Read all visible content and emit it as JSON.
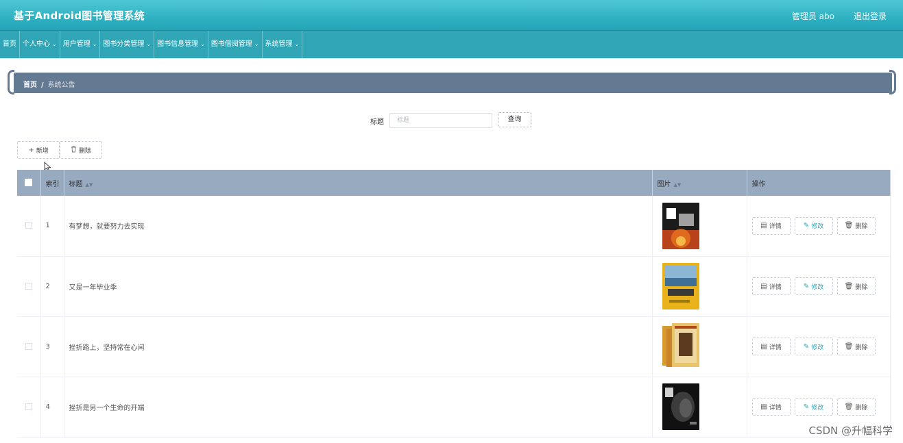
{
  "header": {
    "app_title": "基于Android图书管理系统",
    "user": "管理员 abo",
    "logout": "退出登录"
  },
  "nav": [
    {
      "label": "首页",
      "dropdown": false
    },
    {
      "label": "个人中心",
      "dropdown": true
    },
    {
      "label": "用户管理",
      "dropdown": true
    },
    {
      "label": "图书分类管理",
      "dropdown": true
    },
    {
      "label": "图书信息管理",
      "dropdown": true
    },
    {
      "label": "图书借阅管理",
      "dropdown": true
    },
    {
      "label": "系统管理",
      "dropdown": true
    }
  ],
  "breadcrumb": {
    "home": "首页",
    "separator": "/",
    "current": "系统公告"
  },
  "search": {
    "label": "标题",
    "placeholder": "标题",
    "button": "查询"
  },
  "actions": {
    "add": "新增",
    "delete": "删除"
  },
  "table": {
    "headers": {
      "index": "索引",
      "title": "标题",
      "image": "图片",
      "ops": "操作"
    },
    "rows": [
      {
        "index": "1",
        "title": "有梦想，就要努力去实现",
        "thumb": "book-cover-dark-fire"
      },
      {
        "index": "2",
        "title": "又是一年毕业季",
        "thumb": "book-cover-yellow"
      },
      {
        "index": "3",
        "title": "挫折路上，坚持常在心间",
        "thumb": "book-cover-box-set"
      },
      {
        "index": "4",
        "title": "挫折是另一个生命的开端",
        "thumb": "book-cover-portrait"
      }
    ],
    "row_ops": {
      "detail": "详情",
      "edit": "修改",
      "remove": "删除"
    }
  },
  "colors": {
    "header": "#2fb1c2",
    "nav": "#2fa5b6",
    "breadcrumb": "#647a92",
    "table_header": "#98aac0",
    "edit_accent": "#2aa3b5"
  },
  "watermark": "CSDN @升幅科学"
}
